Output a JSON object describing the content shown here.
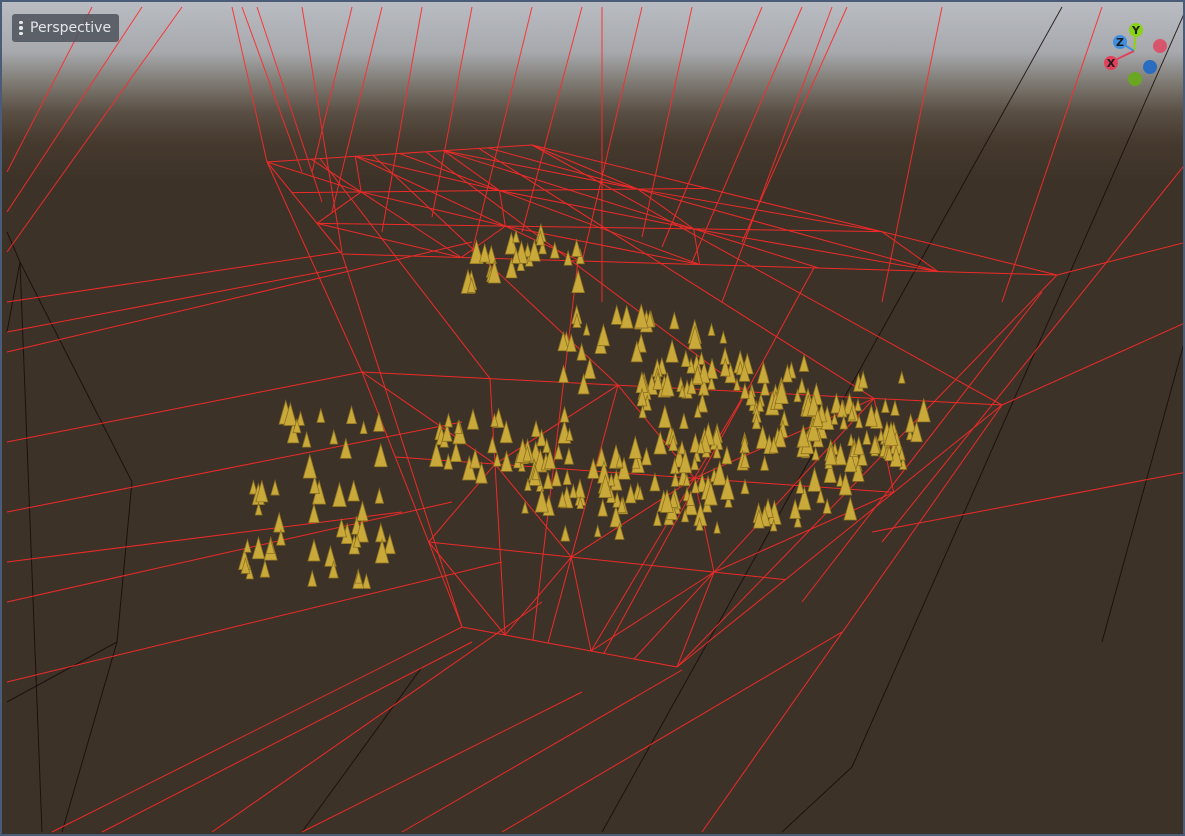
{
  "viewport": {
    "view_menu_label": "Perspective",
    "view_menu_icon": "kebab-menu-icon"
  },
  "gizmo": {
    "axes": [
      {
        "label": "X",
        "color": "#e2405b"
      },
      {
        "label": "Y",
        "color": "#8bd316"
      },
      {
        "label": "Z",
        "color": "#3f8fe0"
      }
    ],
    "negative_axis_colors": [
      "#e2405b",
      "#6aa620",
      "#2a6dc0"
    ]
  },
  "colors": {
    "wireframe": "#ff2a2a",
    "sky_top": "#b9bcc2",
    "ground": "#3d3227",
    "tree_foliage": "#c9a93a",
    "tree_shadow": "#8e7220",
    "viewport_border": "#4a5c78"
  }
}
